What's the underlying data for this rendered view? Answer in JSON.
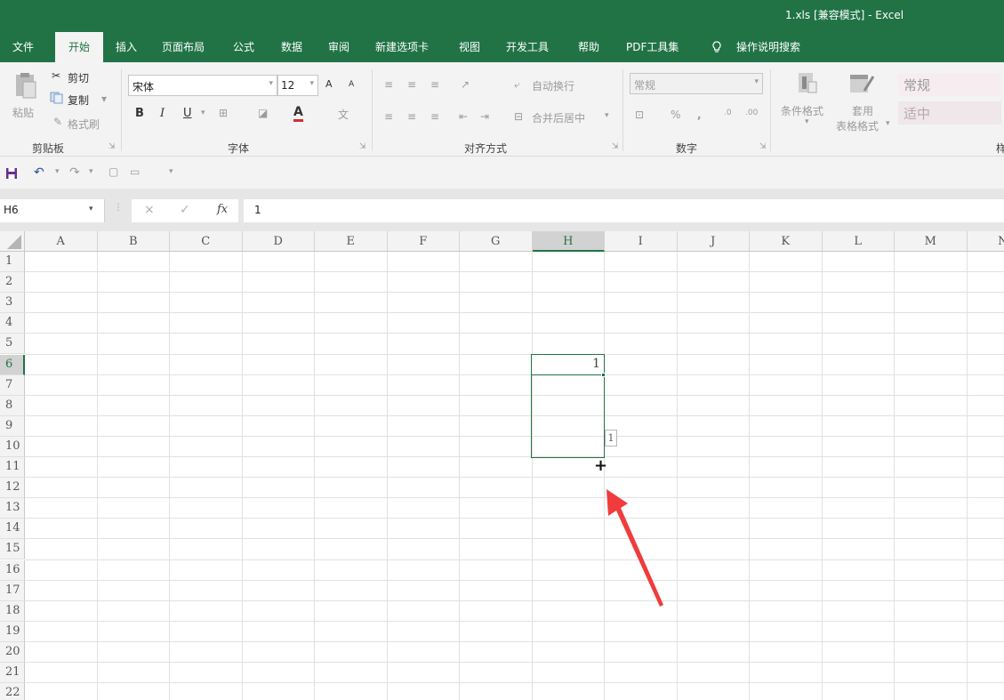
{
  "window": {
    "title": "1.xls [兼容模式] - Excel"
  },
  "tabs": [
    {
      "label": "文件"
    },
    {
      "label": "开始"
    },
    {
      "label": "插入"
    },
    {
      "label": "页面布局"
    },
    {
      "label": "公式"
    },
    {
      "label": "数据"
    },
    {
      "label": "审阅"
    },
    {
      "label": "新建选项卡"
    },
    {
      "label": "视图"
    },
    {
      "label": "开发工具"
    },
    {
      "label": "帮助"
    },
    {
      "label": "PDF工具集"
    },
    {
      "label": "操作说明搜索"
    }
  ],
  "active_tab": "开始",
  "ribbon": {
    "clipboard": {
      "paste": "粘贴",
      "cut": "剪切",
      "copy": "复制",
      "format_painter": "格式刷",
      "group": "剪贴板"
    },
    "font": {
      "name": "宋体",
      "size": "12",
      "group": "字体",
      "bold": "B",
      "italic": "I",
      "underline": "U",
      "grow": "A",
      "shrink": "A",
      "color_a": "A",
      "phonetic": "文"
    },
    "alignment": {
      "wrap": "自动换行",
      "merge": "合并后居中",
      "group": "对齐方式"
    },
    "number": {
      "format": "常规",
      "percent": "%",
      "comma": ",",
      "group": "数字"
    },
    "styles": {
      "conditional": "条件格式",
      "table_format_line1": "套用",
      "table_format_line2": "表格格式",
      "style_normal": "常规",
      "style_neutral": "适中",
      "group": "样"
    }
  },
  "formula_bar": {
    "name_box": "H6",
    "fx": "fx",
    "cancel": "×",
    "enter": "✓",
    "content": "1"
  },
  "columns": [
    "A",
    "B",
    "C",
    "D",
    "E",
    "F",
    "G",
    "H",
    "I",
    "J",
    "K",
    "L",
    "M",
    "N"
  ],
  "selected_column": "H",
  "rows": [
    "1",
    "2",
    "3",
    "4",
    "5",
    "6",
    "7",
    "8",
    "9",
    "10",
    "11",
    "12",
    "13",
    "14",
    "15",
    "16",
    "17",
    "18",
    "19",
    "20",
    "21",
    "22"
  ],
  "selected_row": "6",
  "cells": {
    "H6": "1"
  },
  "autofill_tooltip": "1",
  "fill_cursor": "+",
  "colors": {
    "excel_green": "#217346",
    "annotation_arrow": "#f03c3c",
    "selection": "#217346"
  }
}
